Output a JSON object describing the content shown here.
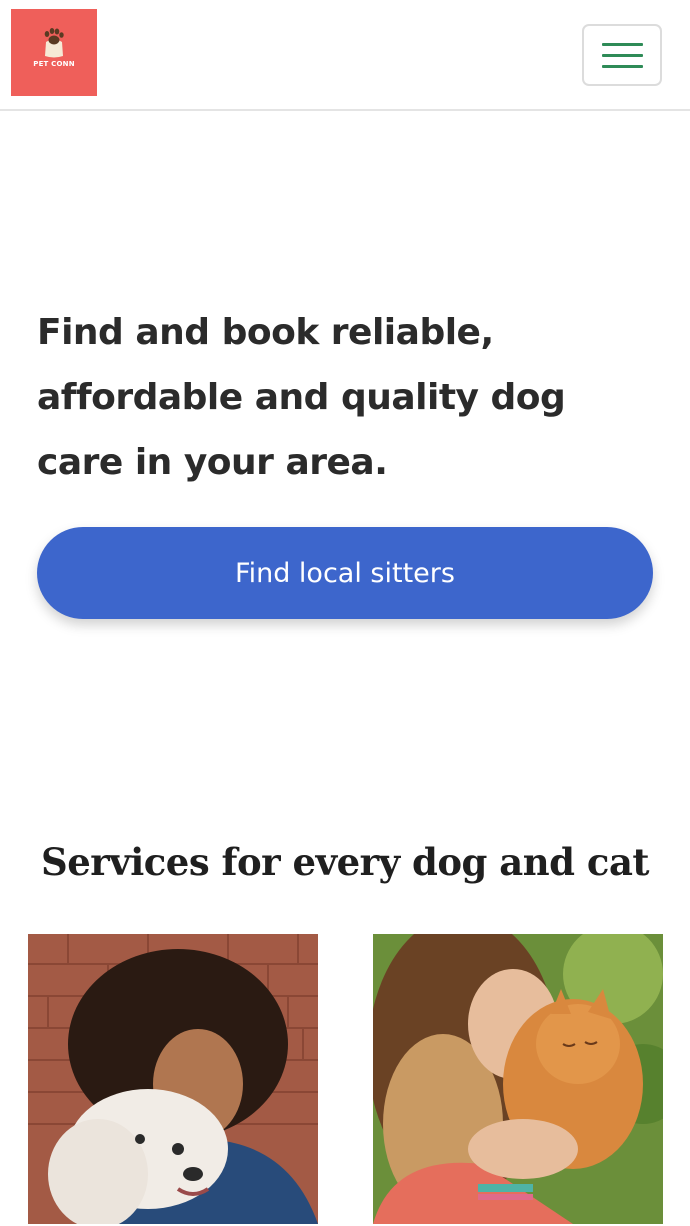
{
  "header": {
    "logo_text": "PET CONN",
    "logo_color": "#ef5f5a",
    "menu_icon": "hamburger-menu-icon"
  },
  "hero": {
    "headline": "Find and book reliable, affordable and quality dog care in your area.",
    "cta_label": "Find local sitters",
    "cta_color": "#3d66cc"
  },
  "services": {
    "title": "Services for every dog and cat",
    "cards": [
      {
        "image": "woman-hugging-dog-photo"
      },
      {
        "image": "woman-hugging-cat-photo"
      }
    ]
  }
}
